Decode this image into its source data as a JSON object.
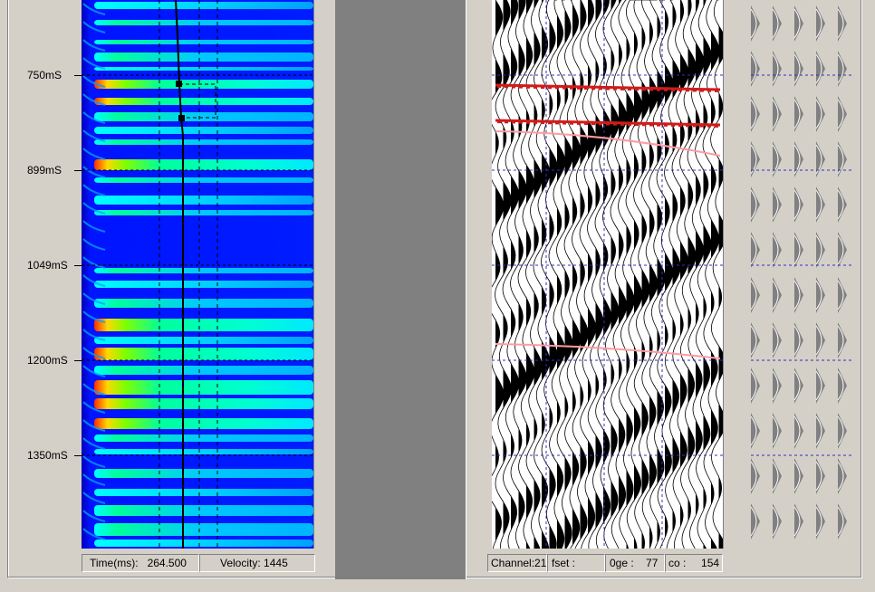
{
  "time_axis": {
    "labels": [
      "750mS",
      "899mS",
      "1049mS",
      "1200mS",
      "1350mS"
    ]
  },
  "semblance_status": {
    "time_label": "Time(ms):",
    "time_value": "264.500",
    "velocity_label": "Velocity:",
    "velocity_value": "1445"
  },
  "gather_status": {
    "channel": "Channel:21",
    "offset": "fset :",
    "range": "0ge :",
    "range_value": "77",
    "co": "co :",
    "co_value": "154"
  },
  "colors": {
    "semblance_low": "#0018ff",
    "semblance_mid": "#00ff7f",
    "semblance_high": "#ff2a00",
    "pick_line": "#000000",
    "horizon_red": "#d21a1a",
    "horizon_pink": "#ff9aa2",
    "grid_blue": "#3030c0",
    "model_fill": "#808080"
  }
}
